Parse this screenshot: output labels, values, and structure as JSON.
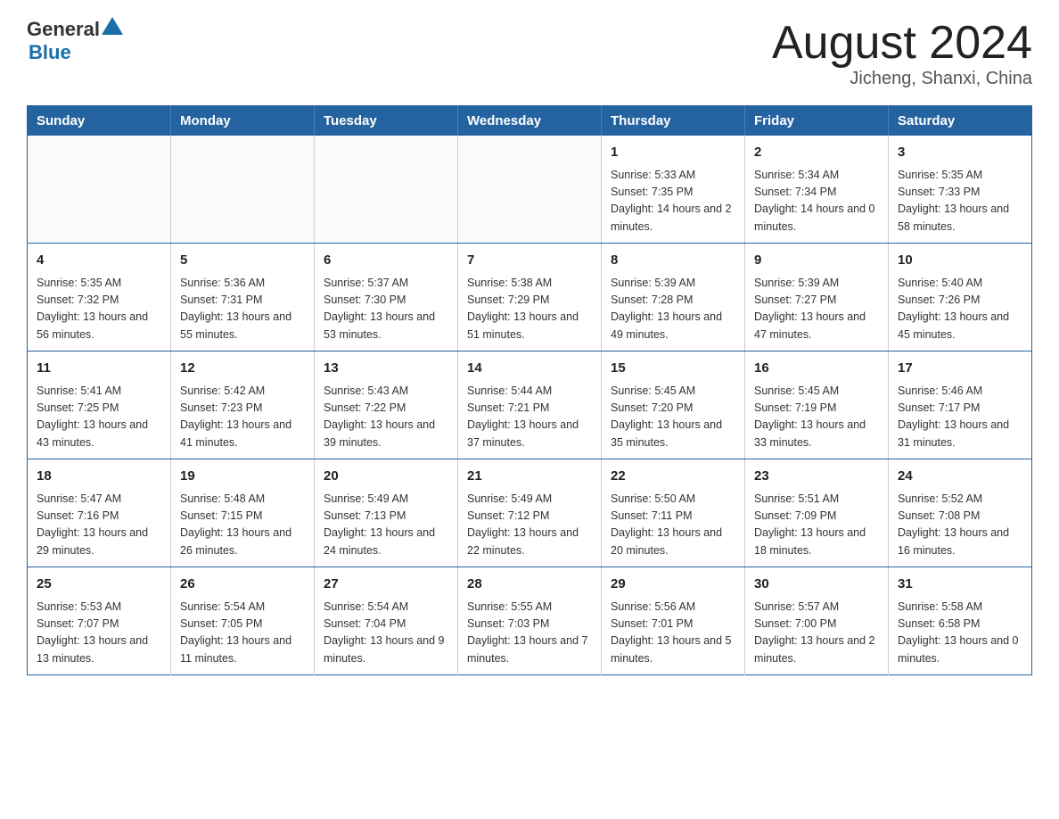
{
  "header": {
    "logo_general": "General",
    "logo_blue": "Blue",
    "title": "August 2024",
    "subtitle": "Jicheng, Shanxi, China"
  },
  "calendar": {
    "days_of_week": [
      "Sunday",
      "Monday",
      "Tuesday",
      "Wednesday",
      "Thursday",
      "Friday",
      "Saturday"
    ],
    "weeks": [
      [
        {
          "day": "",
          "info": ""
        },
        {
          "day": "",
          "info": ""
        },
        {
          "day": "",
          "info": ""
        },
        {
          "day": "",
          "info": ""
        },
        {
          "day": "1",
          "info": "Sunrise: 5:33 AM\nSunset: 7:35 PM\nDaylight: 14 hours\nand 2 minutes."
        },
        {
          "day": "2",
          "info": "Sunrise: 5:34 AM\nSunset: 7:34 PM\nDaylight: 14 hours\nand 0 minutes."
        },
        {
          "day": "3",
          "info": "Sunrise: 5:35 AM\nSunset: 7:33 PM\nDaylight: 13 hours\nand 58 minutes."
        }
      ],
      [
        {
          "day": "4",
          "info": "Sunrise: 5:35 AM\nSunset: 7:32 PM\nDaylight: 13 hours\nand 56 minutes."
        },
        {
          "day": "5",
          "info": "Sunrise: 5:36 AM\nSunset: 7:31 PM\nDaylight: 13 hours\nand 55 minutes."
        },
        {
          "day": "6",
          "info": "Sunrise: 5:37 AM\nSunset: 7:30 PM\nDaylight: 13 hours\nand 53 minutes."
        },
        {
          "day": "7",
          "info": "Sunrise: 5:38 AM\nSunset: 7:29 PM\nDaylight: 13 hours\nand 51 minutes."
        },
        {
          "day": "8",
          "info": "Sunrise: 5:39 AM\nSunset: 7:28 PM\nDaylight: 13 hours\nand 49 minutes."
        },
        {
          "day": "9",
          "info": "Sunrise: 5:39 AM\nSunset: 7:27 PM\nDaylight: 13 hours\nand 47 minutes."
        },
        {
          "day": "10",
          "info": "Sunrise: 5:40 AM\nSunset: 7:26 PM\nDaylight: 13 hours\nand 45 minutes."
        }
      ],
      [
        {
          "day": "11",
          "info": "Sunrise: 5:41 AM\nSunset: 7:25 PM\nDaylight: 13 hours\nand 43 minutes."
        },
        {
          "day": "12",
          "info": "Sunrise: 5:42 AM\nSunset: 7:23 PM\nDaylight: 13 hours\nand 41 minutes."
        },
        {
          "day": "13",
          "info": "Sunrise: 5:43 AM\nSunset: 7:22 PM\nDaylight: 13 hours\nand 39 minutes."
        },
        {
          "day": "14",
          "info": "Sunrise: 5:44 AM\nSunset: 7:21 PM\nDaylight: 13 hours\nand 37 minutes."
        },
        {
          "day": "15",
          "info": "Sunrise: 5:45 AM\nSunset: 7:20 PM\nDaylight: 13 hours\nand 35 minutes."
        },
        {
          "day": "16",
          "info": "Sunrise: 5:45 AM\nSunset: 7:19 PM\nDaylight: 13 hours\nand 33 minutes."
        },
        {
          "day": "17",
          "info": "Sunrise: 5:46 AM\nSunset: 7:17 PM\nDaylight: 13 hours\nand 31 minutes."
        }
      ],
      [
        {
          "day": "18",
          "info": "Sunrise: 5:47 AM\nSunset: 7:16 PM\nDaylight: 13 hours\nand 29 minutes."
        },
        {
          "day": "19",
          "info": "Sunrise: 5:48 AM\nSunset: 7:15 PM\nDaylight: 13 hours\nand 26 minutes."
        },
        {
          "day": "20",
          "info": "Sunrise: 5:49 AM\nSunset: 7:13 PM\nDaylight: 13 hours\nand 24 minutes."
        },
        {
          "day": "21",
          "info": "Sunrise: 5:49 AM\nSunset: 7:12 PM\nDaylight: 13 hours\nand 22 minutes."
        },
        {
          "day": "22",
          "info": "Sunrise: 5:50 AM\nSunset: 7:11 PM\nDaylight: 13 hours\nand 20 minutes."
        },
        {
          "day": "23",
          "info": "Sunrise: 5:51 AM\nSunset: 7:09 PM\nDaylight: 13 hours\nand 18 minutes."
        },
        {
          "day": "24",
          "info": "Sunrise: 5:52 AM\nSunset: 7:08 PM\nDaylight: 13 hours\nand 16 minutes."
        }
      ],
      [
        {
          "day": "25",
          "info": "Sunrise: 5:53 AM\nSunset: 7:07 PM\nDaylight: 13 hours\nand 13 minutes."
        },
        {
          "day": "26",
          "info": "Sunrise: 5:54 AM\nSunset: 7:05 PM\nDaylight: 13 hours\nand 11 minutes."
        },
        {
          "day": "27",
          "info": "Sunrise: 5:54 AM\nSunset: 7:04 PM\nDaylight: 13 hours\nand 9 minutes."
        },
        {
          "day": "28",
          "info": "Sunrise: 5:55 AM\nSunset: 7:03 PM\nDaylight: 13 hours\nand 7 minutes."
        },
        {
          "day": "29",
          "info": "Sunrise: 5:56 AM\nSunset: 7:01 PM\nDaylight: 13 hours\nand 5 minutes."
        },
        {
          "day": "30",
          "info": "Sunrise: 5:57 AM\nSunset: 7:00 PM\nDaylight: 13 hours\nand 2 minutes."
        },
        {
          "day": "31",
          "info": "Sunrise: 5:58 AM\nSunset: 6:58 PM\nDaylight: 13 hours\nand 0 minutes."
        }
      ]
    ]
  }
}
